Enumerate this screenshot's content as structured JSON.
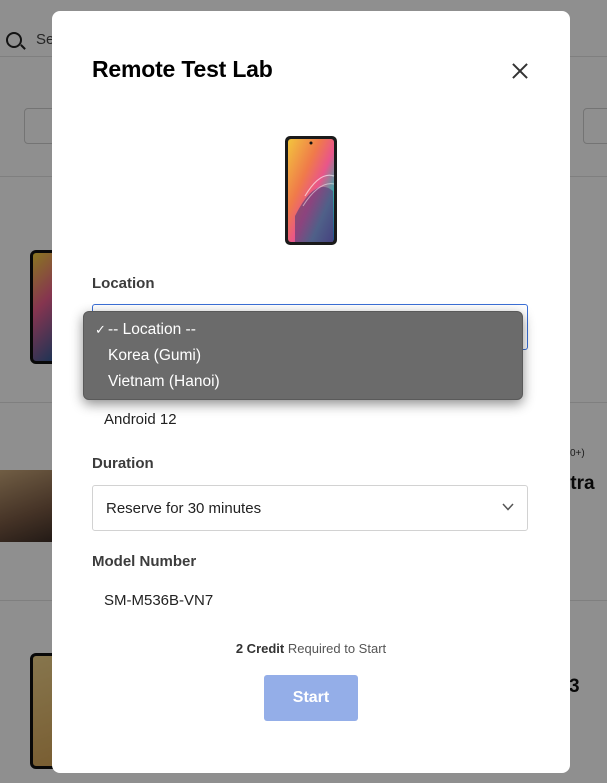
{
  "background": {
    "search_placeholder": "Se",
    "card2_small_text": "0+)",
    "card2_title_fragment": "ltra",
    "card3_title_fragment": "3"
  },
  "modal": {
    "title": "Remote Test Lab",
    "close_icon": "close-icon",
    "device_image": "phone-image",
    "location": {
      "label": "Location",
      "selected": "-- Location --",
      "options": [
        "-- Location --",
        "Korea (Gumi)",
        "Vietnam (Hanoi)"
      ],
      "focus_color": "#3b6fd6"
    },
    "os_value": "Android 12",
    "duration": {
      "label": "Duration",
      "selected": "Reserve for 30 minutes"
    },
    "model_number": {
      "label": "Model Number",
      "value": "SM-M536B-VN7"
    },
    "credit": {
      "amount": "2 Credit",
      "text": " Required to Start"
    },
    "start_button": "Start",
    "start_button_color": "#94aee8"
  },
  "dropdown": {
    "checkmark": "✓"
  }
}
